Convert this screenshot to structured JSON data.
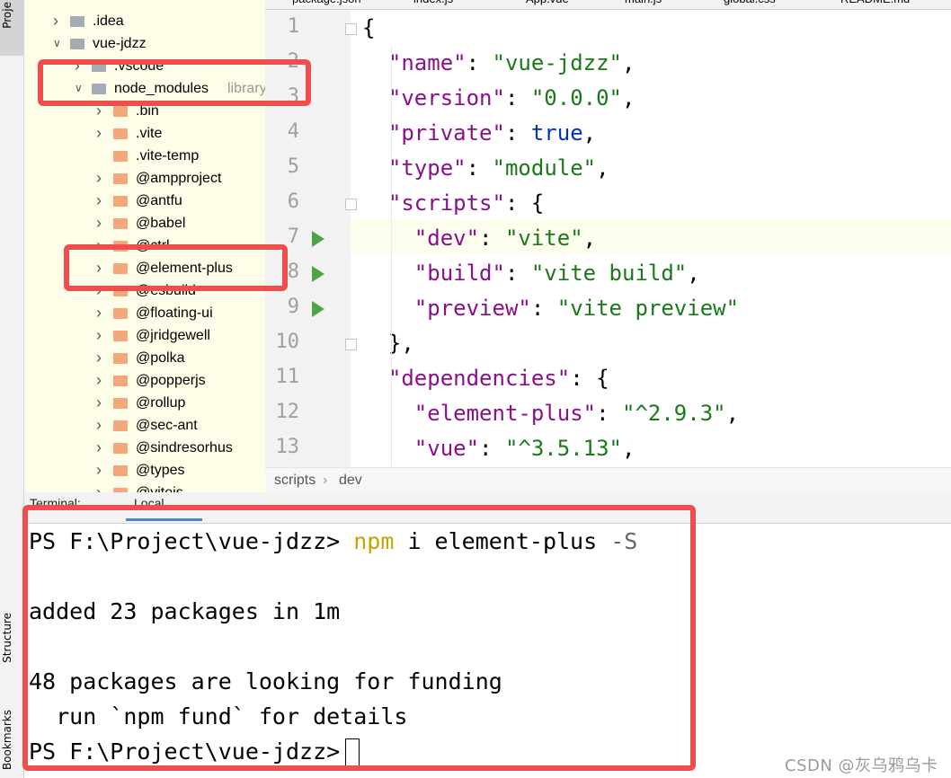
{
  "tool_strip": {
    "project_label": "Proje",
    "structure_label": "Structure",
    "bookmarks_label": "Bookmarks"
  },
  "project_tree": {
    "rows": [
      {
        "label": ".idea",
        "expanded": false,
        "icon": "folder-gray"
      },
      {
        "label": "vue-jdzz",
        "expanded": true,
        "icon": "folder-gray"
      },
      {
        "label": ".vscode",
        "expanded": false,
        "icon": "folder-gray"
      },
      {
        "label": "node_modules",
        "suffix": "library root",
        "expanded": true,
        "icon": "folder-gray"
      },
      {
        "label": ".bin",
        "expanded": false,
        "icon": "folder-orange"
      },
      {
        "label": ".vite",
        "expanded": false,
        "icon": "folder-orange"
      },
      {
        "label": ".vite-temp",
        "expanded": null,
        "icon": "folder-orange"
      },
      {
        "label": "@ampproject",
        "expanded": false,
        "icon": "folder-orange"
      },
      {
        "label": "@antfu",
        "expanded": false,
        "icon": "folder-orange"
      },
      {
        "label": "@babel",
        "expanded": false,
        "icon": "folder-orange"
      },
      {
        "label": "@ctrl",
        "expanded": false,
        "icon": "folder-orange"
      },
      {
        "label": "@element-plus",
        "expanded": false,
        "icon": "folder-orange"
      },
      {
        "label": "@esbuild",
        "expanded": false,
        "icon": "folder-orange"
      },
      {
        "label": "@floating-ui",
        "expanded": false,
        "icon": "folder-orange"
      },
      {
        "label": "@jridgewell",
        "expanded": false,
        "icon": "folder-orange"
      },
      {
        "label": "@polka",
        "expanded": false,
        "icon": "folder-orange"
      },
      {
        "label": "@popperjs",
        "expanded": false,
        "icon": "folder-orange"
      },
      {
        "label": "@rollup",
        "expanded": false,
        "icon": "folder-orange"
      },
      {
        "label": "@sec-ant",
        "expanded": false,
        "icon": "folder-orange"
      },
      {
        "label": "@sindresorhus",
        "expanded": false,
        "icon": "folder-orange"
      },
      {
        "label": "@types",
        "expanded": false,
        "icon": "folder-orange"
      },
      {
        "label": "@vitejs",
        "expanded": false,
        "icon": "folder-orange"
      }
    ]
  },
  "editor_tabs": [
    {
      "label": "package.json",
      "active": true
    },
    {
      "label": "index.js",
      "active": false
    },
    {
      "label": "App.vue",
      "active": false
    },
    {
      "label": "main.js",
      "active": false
    },
    {
      "label": "global.css",
      "active": false
    },
    {
      "label": "README.md",
      "active": false
    }
  ],
  "editor": {
    "line_numbers": [
      "1",
      "2",
      "3",
      "4",
      "5",
      "6",
      "7",
      "8",
      "9",
      "10",
      "11",
      "12",
      "13"
    ],
    "lines": [
      "{",
      "  \"name\": \"vue-jdzz\",",
      "  \"version\": \"0.0.0\",",
      "  \"private\": true,",
      "  \"type\": \"module\",",
      "  \"scripts\": {",
      "    \"dev\": \"vite\",",
      "    \"build\": \"vite build\",",
      "    \"preview\": \"vite preview\"",
      "  },",
      "  \"dependencies\": {",
      "    \"element-plus\": \"^2.9.3\",",
      "    \"vue\": \"^3.5.13\","
    ]
  },
  "breadcrumb": {
    "item1": "scripts",
    "separator": "›",
    "item2": "dev"
  },
  "terminal_header": {
    "title": "Terminal:",
    "tab": "Local"
  },
  "terminal": {
    "prompt1": "PS F:\\Project\\vue-jdzz> ",
    "cmd_npm": "npm",
    "cmd_args": " i element-plus ",
    "cmd_flag": "-S",
    "line_added": "added 23 packages in 1m",
    "line_funding": "48 packages are looking for funding",
    "line_fund": "  run `npm fund` for details",
    "prompt2": "PS F:\\Project\\vue-jdzz>"
  },
  "watermark": "CSDN @灰乌鸦乌卡",
  "colors": {
    "highlight": "#ef4e4e",
    "folder_orange": "#f3a77a",
    "folder_gray": "#a4abb3",
    "json_key": "#8b0f8b",
    "json_string": "#1a7a1a",
    "json_bool": "#0033b3",
    "npm_cmd": "#c9a100"
  }
}
